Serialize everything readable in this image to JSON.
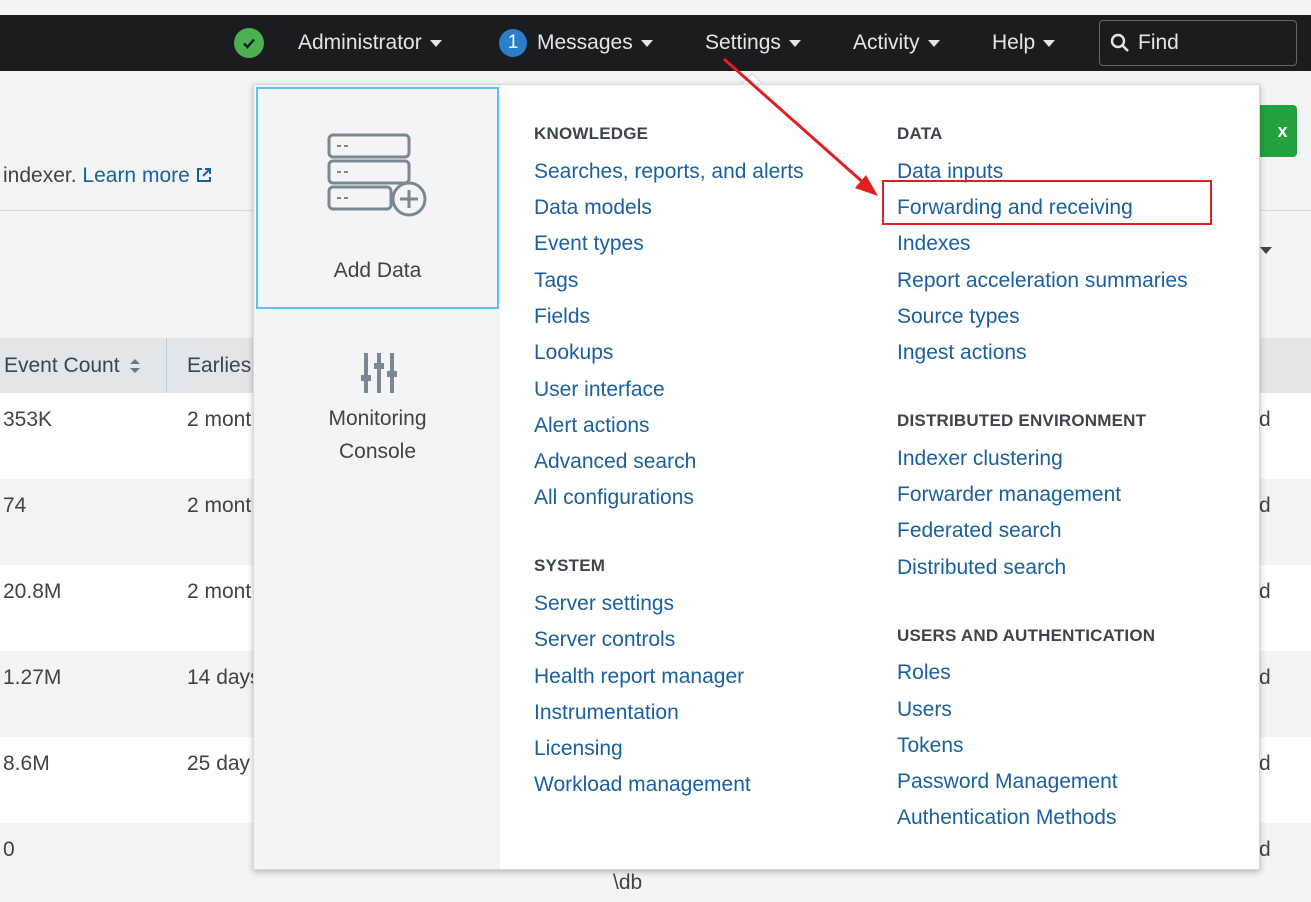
{
  "navbar": {
    "health_status": "ok",
    "admin_label": "Administrator",
    "messages_count": "1",
    "messages_label": "Messages",
    "settings_label": "Settings",
    "activity_label": "Activity",
    "help_label": "Help",
    "find_placeholder": "Find"
  },
  "background": {
    "info_text": "indexer.",
    "learn_more": "Learn more",
    "green_button": "x",
    "table": {
      "headers": [
        "Event Count",
        "Earlies"
      ],
      "rows": [
        {
          "count": "353K",
          "earliest": "2 mont",
          "tail": "d"
        },
        {
          "count": "74",
          "earliest": "2 mont",
          "tail": "d"
        },
        {
          "count": "20.8M",
          "earliest": "2 mont",
          "tail": "d"
        },
        {
          "count": "1.27M",
          "earliest": "14 days",
          "tail": "d"
        },
        {
          "count": "8.6M",
          "earliest": "25 day",
          "tail": "d"
        },
        {
          "count": "0",
          "earliest": "",
          "tail": "d"
        }
      ],
      "path_fragment": "\\db"
    }
  },
  "menu": {
    "tiles": {
      "add_data": "Add Data",
      "monitoring_line1": "Monitoring",
      "monitoring_line2": "Console"
    },
    "knowledge": {
      "heading": "KNOWLEDGE",
      "items": [
        "Searches, reports, and alerts",
        "Data models",
        "Event types",
        "Tags",
        "Fields",
        "Lookups",
        "User interface",
        "Alert actions",
        "Advanced search",
        "All configurations"
      ]
    },
    "system": {
      "heading": "SYSTEM",
      "items": [
        "Server settings",
        "Server controls",
        "Health report manager",
        "Instrumentation",
        "Licensing",
        "Workload management"
      ]
    },
    "data": {
      "heading": "DATA",
      "items": [
        "Data inputs",
        "Forwarding and receiving",
        "Indexes",
        "Report acceleration summaries",
        "Source types",
        "Ingest actions"
      ]
    },
    "distributed": {
      "heading": "DISTRIBUTED ENVIRONMENT",
      "items": [
        "Indexer clustering",
        "Forwarder management",
        "Federated search",
        "Distributed search"
      ]
    },
    "users": {
      "heading": "USERS AND AUTHENTICATION",
      "items": [
        "Roles",
        "Users",
        "Tokens",
        "Password Management",
        "Authentication Methods"
      ]
    }
  },
  "annotation": {
    "highlight_color": "#e02020",
    "highlighted_item": "Forwarding and receiving"
  }
}
